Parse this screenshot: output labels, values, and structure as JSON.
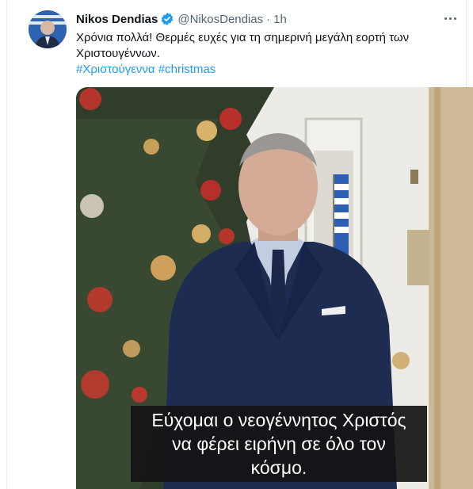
{
  "tweet": {
    "author_name": "Nikos Dendias",
    "author_handle": "@NikosDendias",
    "separator": "·",
    "timestamp": "1h",
    "text": "Χρόνια πολλά! Θερμές ευχές για τη σημερινή μεγάλη εορτή των Χριστουγέννων.",
    "hashtags": [
      "#Χριστούγεννα",
      "#christmas"
    ],
    "verified_icon": "verified-badge-icon",
    "more_icon": "more-options-icon"
  },
  "video": {
    "subtitle_lines": [
      "Εύχομαι ο νεογέννητος Χριστός",
      "να φέρει ειρήνη σε όλο τον",
      "κόσμο."
    ]
  },
  "colors": {
    "link": "#1d9bf0",
    "secondary_text": "#536471",
    "verified": "#1d9bf0"
  }
}
